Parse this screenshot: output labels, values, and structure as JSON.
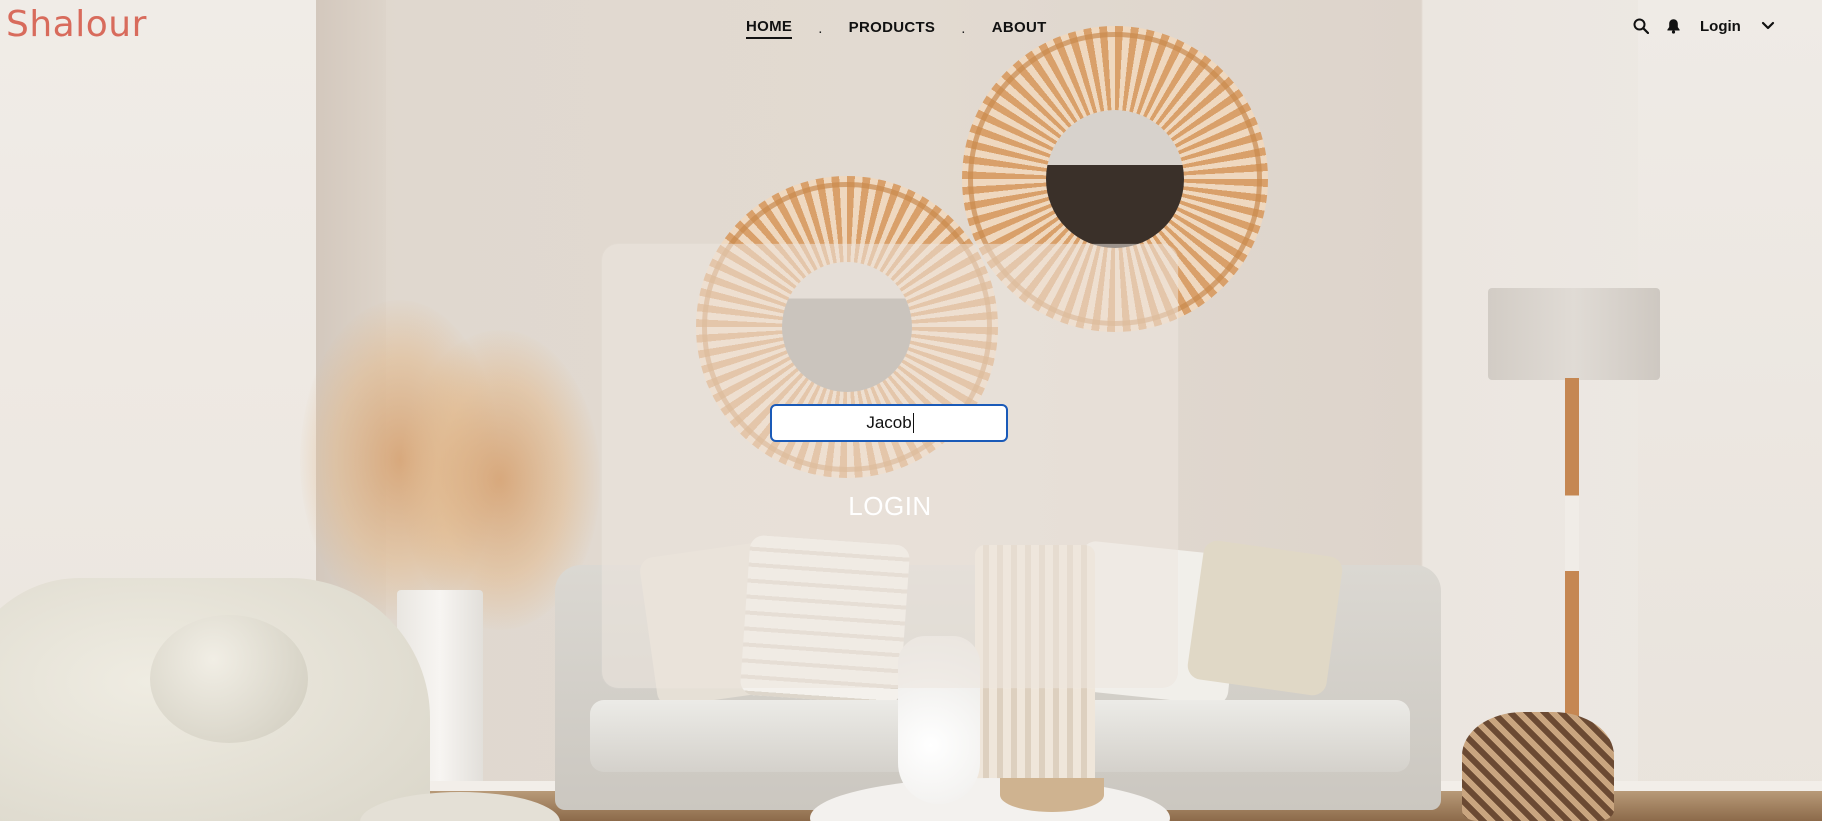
{
  "brand": {
    "logo_text": "Shalour",
    "logo_color": "#d86b5c"
  },
  "nav": {
    "items": [
      {
        "label": "HOME",
        "active": true
      },
      {
        "label": "PRODUCTS",
        "active": false
      },
      {
        "label": "ABOUT",
        "active": false
      }
    ],
    "separator": "."
  },
  "toolbar": {
    "icons": [
      "search-icon",
      "bell-icon"
    ],
    "login_label": "Login",
    "login_dropdown_icon": "chevron-down-icon"
  },
  "login_form": {
    "username_value": "Jacob",
    "submit_label": "LOGIN",
    "focus_color": "#1a5ab8"
  },
  "background": {
    "description_icon": "living-room-image"
  }
}
